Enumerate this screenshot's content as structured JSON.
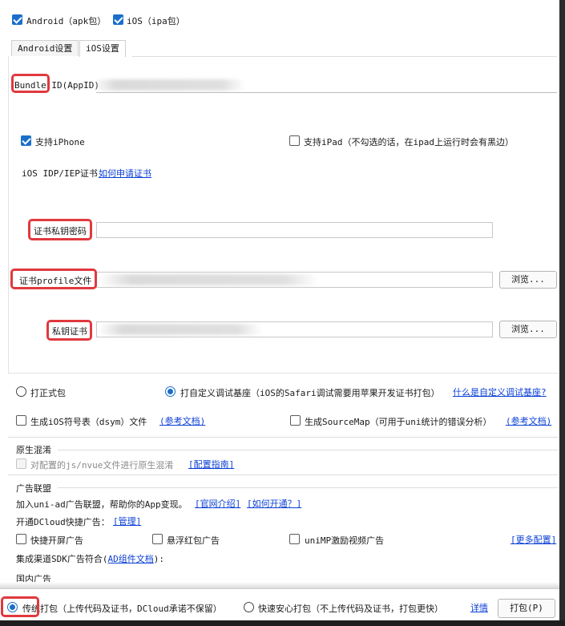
{
  "platforms": {
    "android": "Android（apk包）",
    "ios": "iOS（ipa包）"
  },
  "tabs": [
    "Android设置",
    "iOS设置"
  ],
  "ios": {
    "bundle_label": "Bundle ID(AppID)",
    "support_iphone": "支持iPhone",
    "support_ipad": "支持iPad（不勾选的话，在ipad上运行时会有黑边）",
    "cert_label": "iOS IDP/IEP证书",
    "cert_link": "如何申请证书",
    "key_password_label": "证书私钥密码",
    "profile_label": "证书profile文件",
    "private_cert_label": "私钥证书",
    "browse": "浏览..."
  },
  "build_mode": {
    "formal": "打正式包",
    "custom_base": "打自定义调试基座（iOS的Safari调试需要用苹果开发证书打包）",
    "custom_base_link": "什么是自定义调试基座?"
  },
  "symbols": {
    "dsym": "生成iOS符号表（dsym）文件",
    "dsym_doc": "(参考文档)",
    "sourcemap": "生成SourceMap（可用于uni统计的错误分析）",
    "sourcemap_doc": "(参考文档)"
  },
  "obfuscation": {
    "title": "原生混淆",
    "option": "对配置的js/nvue文件进行原生混淆",
    "guide": "[配置指南]"
  },
  "ads": {
    "title": "广告联盟",
    "intro": "加入uni-ad广告联盟，帮助你的App变现。",
    "intro_link1": "[官网介绍]",
    "intro_link2": "[如何开通？]",
    "dcloud": "开通DCloud快捷广告：",
    "manage": "[管理]",
    "splash": "快捷开屏广告",
    "float_red": "悬浮红包广告",
    "video": "uniMP激励视频广告",
    "more": "[更多配置]",
    "sdk_prefix": "集成渠道SDK广告符合(",
    "sdk_link": "AD组件文档",
    "sdk_suffix": "):",
    "domestic": "国内广告"
  },
  "footer": {
    "traditional": "传统打包（上传代码及证书，DCloud承诺不保留）",
    "fast": "快速安心打包（不上传代码及证书，打包更快）",
    "details": "详情",
    "pack": "打包(P)"
  },
  "colors": {
    "accent": "#1a6fc9",
    "highlight": "#e0393e",
    "link": "#0a3fd6"
  }
}
